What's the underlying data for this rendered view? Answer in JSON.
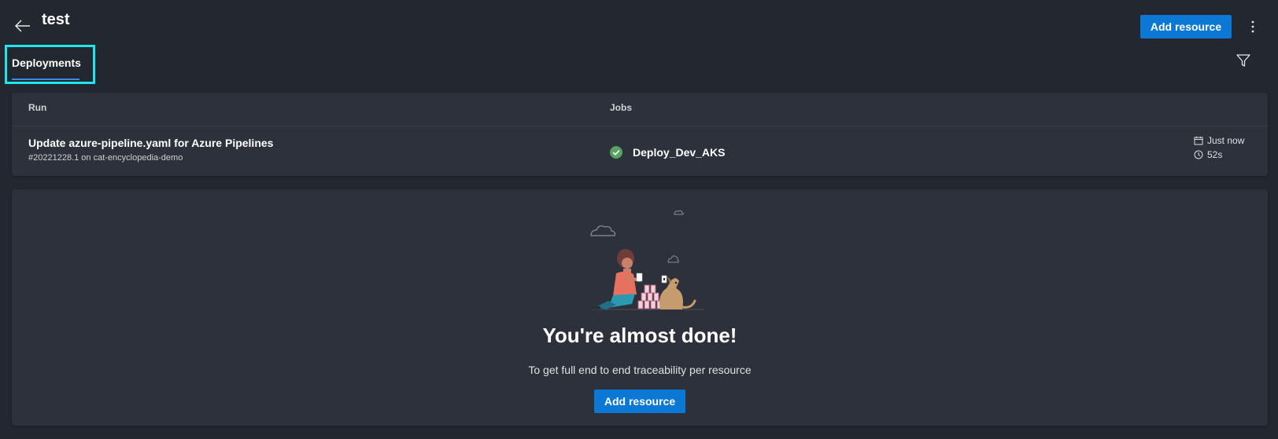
{
  "header": {
    "title": "test",
    "add_resource_label": "Add resource"
  },
  "tabs": [
    {
      "label": "Deployments"
    }
  ],
  "runs_table": {
    "columns": [
      "Run",
      "Jobs"
    ],
    "rows": [
      {
        "title": "Update azure-pipeline.yaml for Azure Pipelines",
        "subtitle": "#20221228.1 on cat-encyclopedia-demo",
        "job": "Deploy_Dev_AKS",
        "job_status": "succeeded",
        "time": "Just now",
        "duration": "52s"
      }
    ]
  },
  "empty_state": {
    "title": "You're almost done!",
    "description": "To get full end to end traceability per resource",
    "button_label": "Add resource"
  },
  "colors": {
    "background": "#232730",
    "card": "#2c313b",
    "accent": "#0a78d4",
    "highlight": "#1fe6ee",
    "success": "#55a362"
  },
  "icons": {
    "back": "arrow-left-icon",
    "more": "more-vertical-icon",
    "filter": "filter-icon",
    "status": "check-circle-icon",
    "calendar": "calendar-icon",
    "clock": "clock-icon"
  }
}
